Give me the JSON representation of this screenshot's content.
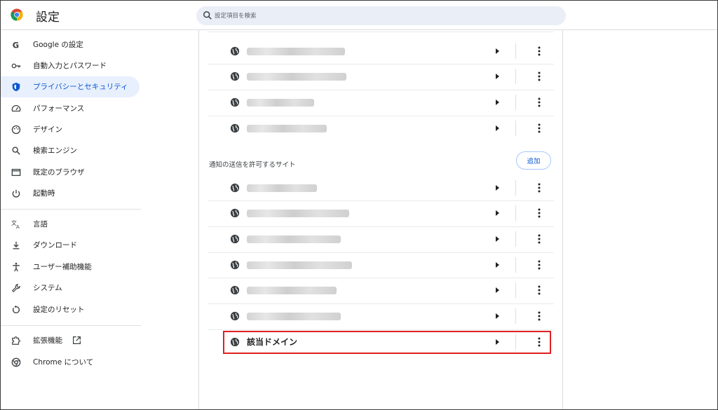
{
  "header": {
    "title": "設定",
    "search_placeholder": "設定項目を検索"
  },
  "sidebar": {
    "items": [
      {
        "label": "Google の設定",
        "icon": "google-icon"
      },
      {
        "label": "自動入力とパスワード",
        "icon": "key-icon"
      },
      {
        "label": "プライバシーとセキュリティ",
        "icon": "shield-icon",
        "active": true
      },
      {
        "label": "パフォーマンス",
        "icon": "speedometer-icon"
      },
      {
        "label": "デザイン",
        "icon": "palette-icon"
      },
      {
        "label": "検索エンジン",
        "icon": "search-icon"
      },
      {
        "label": "既定のブラウザ",
        "icon": "browser-window-icon"
      },
      {
        "label": "起動時",
        "icon": "power-icon"
      },
      {
        "label": "言語",
        "icon": "translate-icon"
      },
      {
        "label": "ダウンロード",
        "icon": "download-icon"
      },
      {
        "label": "ユーザー補助機能",
        "icon": "accessibility-icon"
      },
      {
        "label": "システム",
        "icon": "wrench-icon"
      },
      {
        "label": "設定のリセット",
        "icon": "reset-icon"
      },
      {
        "label": "拡張機能",
        "icon": "puzzle-icon",
        "external": true
      },
      {
        "label": "Chrome について",
        "icon": "chrome-icon"
      }
    ]
  },
  "main": {
    "section_title": "通知の送信を許可するサイト",
    "add_label": "追加",
    "target_site": "該当ドメイン"
  },
  "colors": {
    "accent": "#0b57d0",
    "active_bg": "#e8f0fe",
    "highlight_border": "#e02020"
  }
}
